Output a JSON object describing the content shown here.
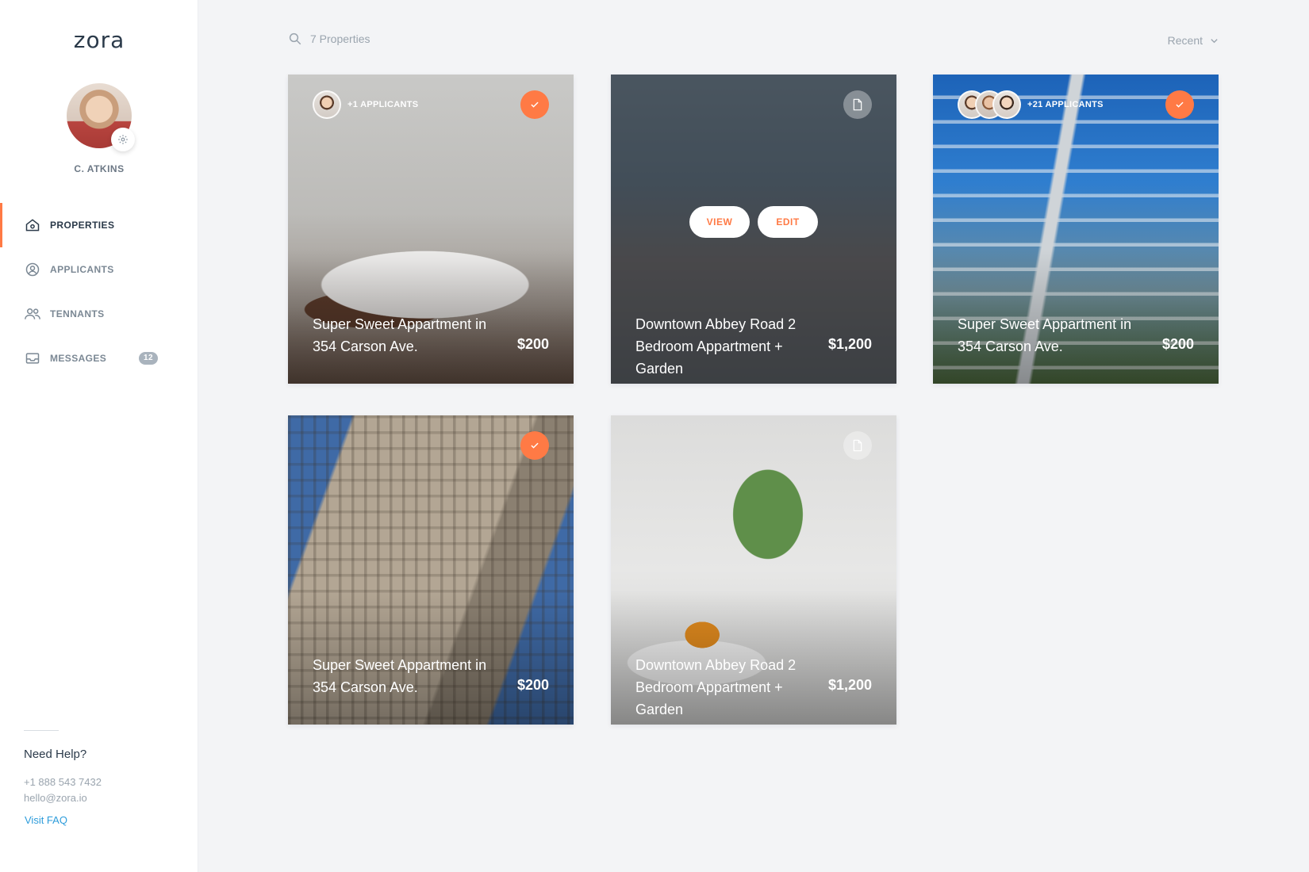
{
  "app": {
    "logo": "zora"
  },
  "user": {
    "name": "C. ATKINS"
  },
  "nav": {
    "items": [
      {
        "label": "PROPERTIES",
        "icon": "home-icon",
        "active": true
      },
      {
        "label": "APPLICANTS",
        "icon": "user-circle-icon",
        "active": false
      },
      {
        "label": "TENNANTS",
        "icon": "users-icon",
        "active": false
      },
      {
        "label": "MESSAGES",
        "icon": "inbox-icon",
        "active": false,
        "badge": "12"
      }
    ]
  },
  "help": {
    "title": "Need Help?",
    "phone": "+1 888 543 7432",
    "email": "hello@zora.io",
    "faq": "Visit FAQ"
  },
  "toolbar": {
    "search_text": "7 Properties",
    "sort_label": "Recent"
  },
  "cards": [
    {
      "title": "Super Sweet Appartment in 354 Carson Ave.",
      "price": "$200",
      "applicants": "+1 APPLICANTS",
      "status": "approved"
    },
    {
      "title": "Downtown Abbey Road 2 Bedroom Appartment + Garden",
      "price": "$1,200",
      "status": "document",
      "view_label": "VIEW",
      "edit_label": "EDIT"
    },
    {
      "title": "Super Sweet Appartment in 354 Carson Ave.",
      "price": "$200",
      "applicants": "+21 APPLICANTS",
      "status": "approved"
    },
    {
      "title": "Super Sweet Appartment in 354 Carson Ave.",
      "price": "$200",
      "status": "approved"
    },
    {
      "title": "Downtown Abbey Road 2 Bedroom Appartment + Garden",
      "price": "$1,200",
      "status": "document"
    }
  ],
  "colors": {
    "accent": "#ff7a45",
    "link": "#2d9cdb",
    "background": "#f3f4f6",
    "sidebar": "#ffffff"
  }
}
